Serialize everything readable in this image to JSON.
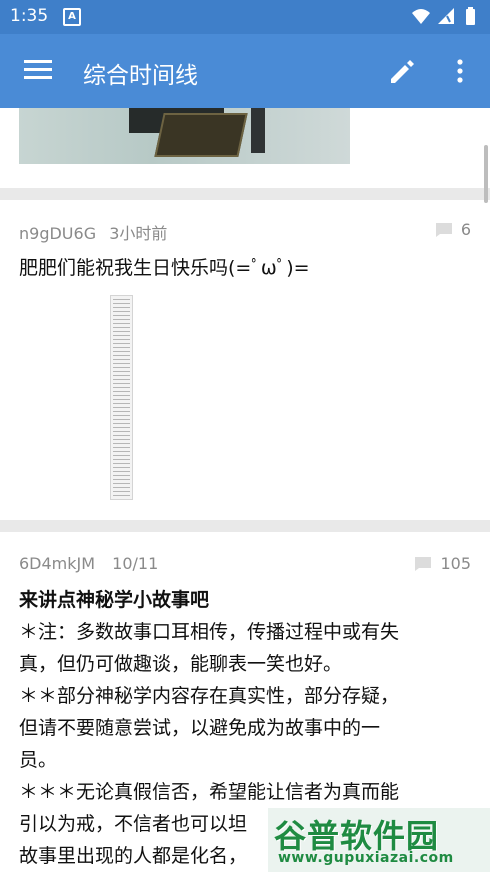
{
  "status_bar": {
    "time": "1:35",
    "notification_letter": "A"
  },
  "app_bar": {
    "title": "综合时间线"
  },
  "posts": [
    {
      "user": "n9gDU6G",
      "time": "3小时前",
      "comments": "6",
      "text": "肥肥们能祝我生日快乐吗(=ﾟωﾟ)="
    },
    {
      "user": "6D4mkJM",
      "time": "10/11",
      "comments": "105",
      "title": "来讲点神秘学小故事吧",
      "lines": [
        "＊注：多数故事口耳相传，传播过程中或有失",
        "真，但仍可做趣谈，能聊表一笑也好。",
        "＊＊部分神秘学内容存在真实性，部分存疑，",
        "但请不要随意尝试，以避免成为故事中的一",
        "员。",
        "＊＊＊无论真假信否，希望能让信者为真而能",
        "引以为戒，不信者也可以坦",
        "故事里出现的人都是化名，"
      ]
    }
  ],
  "watermark": {
    "logo": "谷普软件园",
    "url": "www.gupuxiazai.com"
  }
}
